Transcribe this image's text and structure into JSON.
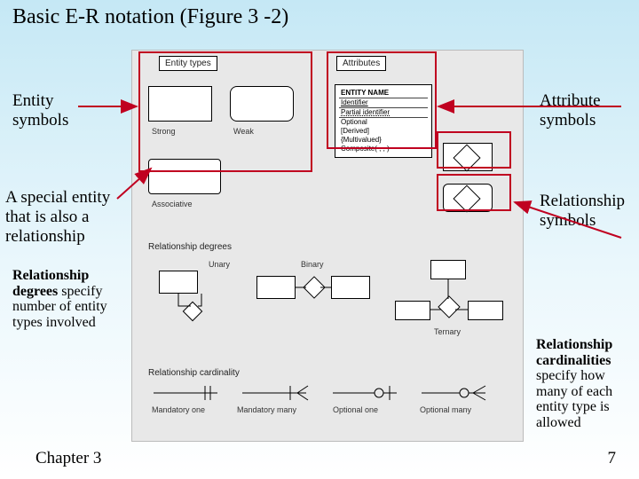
{
  "title": "Basic E-R notation (Figure 3 -2)",
  "side": {
    "entity": "Entity\nsymbols",
    "attribute": "Attribute\nsymbols",
    "special": "A special entity\nthat is also a\nrelationship",
    "relationship": "Relationship\nsymbols",
    "degrees_bold": "Relationship degrees",
    "degrees_rest": "specify number of entity types involved",
    "card_bold": "Relationship cardinalities",
    "card_rest": "specify how many of each entity type is allowed"
  },
  "panel": {
    "headers": {
      "entity": "Entity types",
      "attributes": "Attributes",
      "degrees": "Relationship degrees",
      "cardinality": "Relationship cardinality"
    },
    "entity_types": {
      "strong": "Strong",
      "weak": "Weak",
      "associative": "Associative"
    },
    "degree_labels": {
      "unary": "Unary",
      "binary": "Binary",
      "ternary": "Ternary"
    },
    "attr_rows": [
      "ENTITY NAME",
      "Identifier",
      "Partial identifier",
      "Optional",
      "[Derived]",
      "{Multivalued}",
      "Composite( , , )"
    ],
    "cardinalities": [
      "Mandatory one",
      "Mandatory many",
      "Optional one",
      "Optional many"
    ]
  },
  "footer": {
    "left": "Chapter 3",
    "right": "7"
  }
}
